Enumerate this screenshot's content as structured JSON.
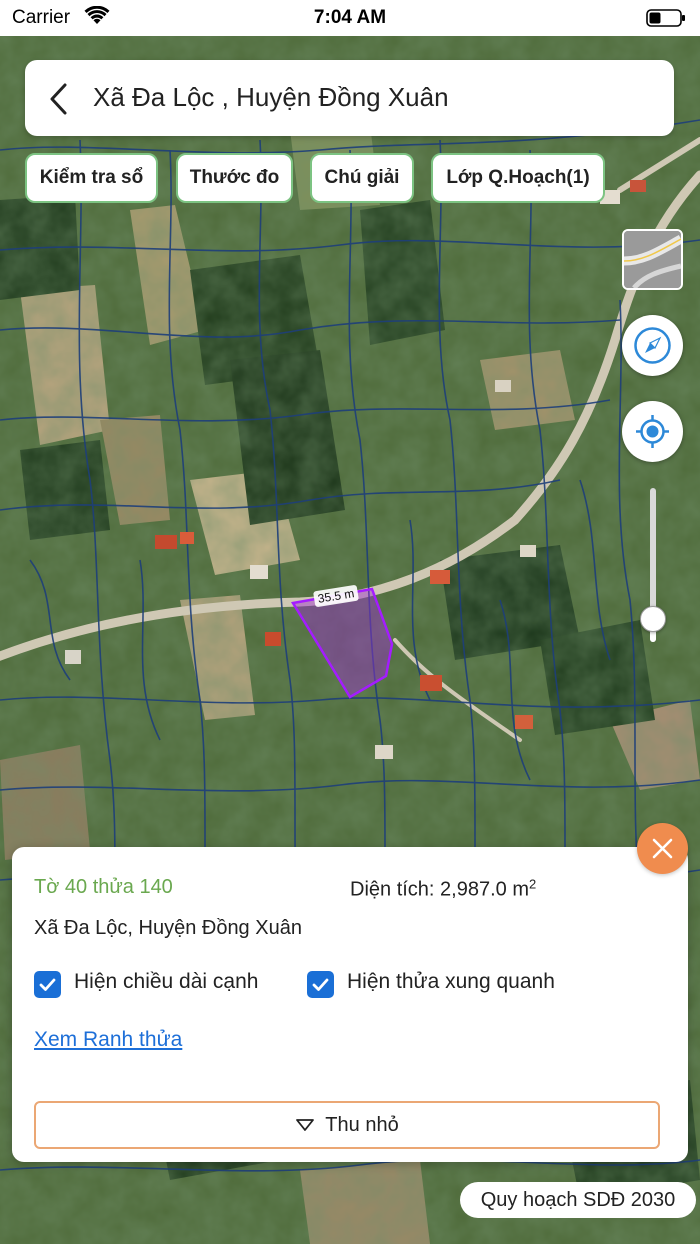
{
  "status_bar": {
    "carrier": "Carrier",
    "time": "7:04 AM"
  },
  "header": {
    "title": "Xã Đa Lộc , Huyện Đồng Xuân",
    "back_icon": "chevron-left-icon"
  },
  "toolbar": {
    "buttons": [
      {
        "label": "Kiểm tra sổ"
      },
      {
        "label": "Thước đo"
      },
      {
        "label": "Chú giải"
      },
      {
        "label": "Lớp Q.Hoạch(1)"
      }
    ]
  },
  "map": {
    "measurement_label": "35.5 m",
    "parcel_color": "#9b2fd1",
    "parcel_border_color": "#a41cff",
    "boundary_color": "#1e3f7a",
    "road_color": "#cfc8b4",
    "controls": {
      "layer_icon": "road-layer-icon",
      "compass_icon": "compass-icon",
      "locate_icon": "locate-icon",
      "zoom_level": 0.15
    }
  },
  "info_panel": {
    "parcel_id": "Tờ 40 thửa 140",
    "area_label": "Diện tích: 2,987.0 m",
    "area_superscript": "2",
    "location": "Xã Đa Lộc, Huyện Đồng Xuân",
    "checkboxes": [
      {
        "label": "Hiện chiều dài cạnh",
        "checked": true
      },
      {
        "label": "Hiện thửa xung quanh",
        "checked": true
      }
    ],
    "link_label": "Xem Ranh thửa",
    "collapse_label": "Thu nhỏ",
    "close_icon": "close-icon"
  },
  "planning_badge": "Quy hoạch SDĐ 2030",
  "colors": {
    "accent_green": "#7cc382",
    "parcel_id_green": "#6aa84f",
    "link_blue": "#1d6fd8",
    "checkbox_blue": "#1a6fd6",
    "collapse_border": "#eba774",
    "close_orange": "#f08c4e"
  }
}
